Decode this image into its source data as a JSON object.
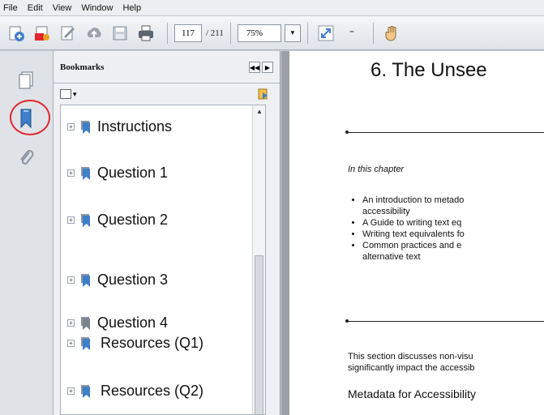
{
  "menu": [
    "File",
    "Edit",
    "View",
    "Window",
    "Help"
  ],
  "toolbar": {
    "icons": [
      "create-icon",
      "convert-icon",
      "sign-icon",
      "cloud-icon",
      "save-icon",
      "print-icon"
    ],
    "page_current": "117",
    "page_total": "/ 211",
    "zoom": "75%",
    "zoom_dropdown": "▾",
    "more_tools": "⁼",
    "hand_tool_icon": "hand-icon"
  },
  "left_strip": {
    "pages_icon": "pages-icon",
    "bookmarks_icon": "bookmark-icon",
    "attachments_icon": "paperclip-icon"
  },
  "bookmarks_panel": {
    "title": "Bookmarks",
    "collapse_left": "◀◀",
    "collapse_right": "▶",
    "options_arrow": "▾",
    "items": [
      {
        "label": "Instructions"
      },
      {
        "label": "Question 1"
      },
      {
        "label": "Question 2"
      },
      {
        "label": "Question 3"
      },
      {
        "label": "Question 4"
      },
      {
        "label": "Resources (Q1)"
      },
      {
        "label": "Resources (Q2)"
      }
    ]
  },
  "document": {
    "title": "6. The Unsee",
    "chapter_label": "In this chapter",
    "bullets": [
      "An introduction to metado",
      "accessibility",
      "A Guide to writing text eq",
      "Writing text equivalents fo",
      "Common practices and e",
      "alternative text"
    ],
    "body_line1": "This section discusses non-visu",
    "body_line2": "significantly impact the accessib",
    "section_heading": "Metadata for Accessibility"
  },
  "colors": {
    "highlight": "#e0262e",
    "bookmark_blue": "#3f7fc9"
  }
}
